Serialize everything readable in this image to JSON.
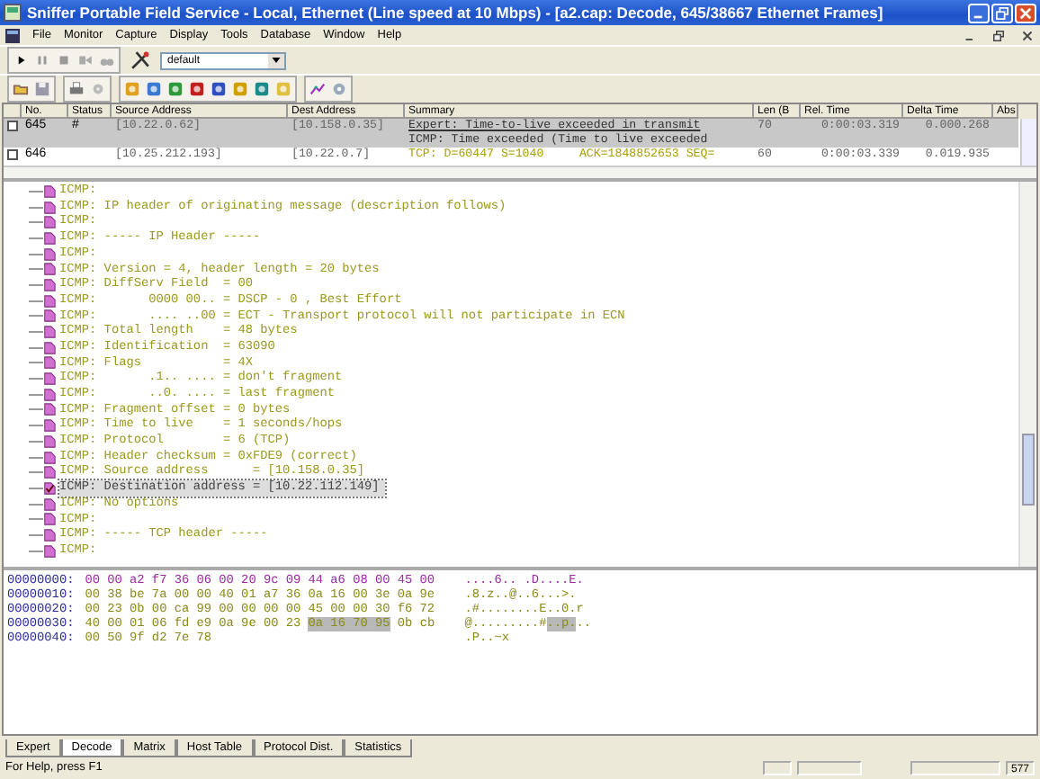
{
  "window": {
    "title": "Sniffer Portable Field Service - Local, Ethernet (Line speed at 10 Mbps) - [a2.cap: Decode, 645/38667 Ethernet Frames]"
  },
  "menu": [
    "File",
    "Monitor",
    "Capture",
    "Display",
    "Tools",
    "Database",
    "Window",
    "Help"
  ],
  "toolbar": {
    "profile": "default"
  },
  "packets": {
    "columns": [
      "No.",
      "Status",
      "Source Address",
      "Dest Address",
      "Summary",
      "Len (B",
      "Rel. Time",
      "Delta Time",
      "Abs"
    ],
    "rows": [
      {
        "checked": false,
        "selected": true,
        "no": "645",
        "status": "#",
        "source": "[10.22.0.62]",
        "dest": "[10.158.0.35]",
        "summary": [
          "Expert: Time-to-live exceeded in transmit",
          "ICMP: Time exceeded (Time to live exceeded"
        ],
        "len": "70",
        "rel_time": "0:00:03.319",
        "delta_time": "0.000.268"
      },
      {
        "checked": false,
        "selected": false,
        "no": "646",
        "status": "",
        "source": "[10.25.212.193]",
        "dest": "[10.22.0.7]",
        "summary": [
          "TCP: D=60447 S=1040     ACK=1848852653 SEQ="
        ],
        "len": "60",
        "rel_time": "0:00:03.339",
        "delta_time": "0.019.935"
      }
    ]
  },
  "decode": [
    {
      "text": "ICMP:",
      "selected": false
    },
    {
      "text": "ICMP: IP header of originating message (description follows)",
      "selected": false
    },
    {
      "text": "ICMP:",
      "selected": false
    },
    {
      "text": "ICMP: ----- IP Header -----",
      "selected": false
    },
    {
      "text": "ICMP:",
      "selected": false
    },
    {
      "text": "ICMP: Version = 4, header length = 20 bytes",
      "selected": false
    },
    {
      "text": "ICMP: DiffServ Field  = 00",
      "selected": false
    },
    {
      "text": "ICMP:       0000 00.. = DSCP - 0 , Best Effort",
      "selected": false
    },
    {
      "text": "ICMP:       .... ..00 = ECT - Transport protocol will not participate in ECN",
      "selected": false
    },
    {
      "text": "ICMP: Total length    = 48 bytes",
      "selected": false
    },
    {
      "text": "ICMP: Identification  = 63090",
      "selected": false
    },
    {
      "text": "ICMP: Flags           = 4X",
      "selected": false
    },
    {
      "text": "ICMP:       .1.. .... = don't fragment",
      "selected": false
    },
    {
      "text": "ICMP:       ..0. .... = last fragment",
      "selected": false
    },
    {
      "text": "ICMP: Fragment offset = 0 bytes",
      "selected": false
    },
    {
      "text": "ICMP: Time to live    = 1 seconds/hops",
      "selected": false
    },
    {
      "text": "ICMP: Protocol        = 6 (TCP)",
      "selected": false
    },
    {
      "text": "ICMP: Header checksum = 0xFDE9 (correct)",
      "selected": false
    },
    {
      "text": "ICMP: Source address      = [10.158.0.35]",
      "selected": false
    },
    {
      "text": "ICMP: Destination address = [10.22.112.149]",
      "selected": true
    },
    {
      "text": "ICMP: No options",
      "selected": false
    },
    {
      "text": "ICMP:",
      "selected": false
    },
    {
      "text": "ICMP: ----- TCP header -----",
      "selected": false
    },
    {
      "text": "ICMP:",
      "selected": false
    }
  ],
  "hex": [
    {
      "offset": "00000000:",
      "color": "#9a2aa0",
      "bytes": [
        {
          "text": "00 00 a2 f7 36 06 00 20 9c 09 44 a6 08 00 45 00",
          "selected": false
        }
      ],
      "ascii": [
        {
          "text": "....6.. .D....E.",
          "selected": false
        }
      ]
    },
    {
      "offset": "00000010:",
      "color": "#8a8a1a",
      "bytes": [
        {
          "text": "00 38 be 7a 00 00 40 01 a7 36 0a 16 00 3e 0a 9e",
          "selected": false
        }
      ],
      "ascii": [
        {
          "text": ".8.z..@..6...>.",
          "selected": false
        }
      ]
    },
    {
      "offset": "00000020:",
      "color": "#8a8a1a",
      "bytes": [
        {
          "text": "00 23 0b 00 ca 99 00 00 00 00 45 00 00 30 f6 72",
          "selected": false
        }
      ],
      "ascii": [
        {
          "text": ".#........E..0.r",
          "selected": false
        }
      ]
    },
    {
      "offset": "00000030:",
      "color": "#8a8a1a",
      "bytes": [
        {
          "text": "40 00 01 06 fd e9 0a 9e 00 23 ",
          "selected": false
        },
        {
          "text": "0a 16 70 95",
          "selected": true
        },
        {
          "text": " 0b cb",
          "selected": false
        }
      ],
      "ascii": [
        {
          "text": "@.........#",
          "selected": false
        },
        {
          "text": "..p.",
          "selected": true
        },
        {
          "text": "..",
          "selected": false
        }
      ]
    },
    {
      "offset": "00000040:",
      "color": "#8a8a1a",
      "bytes": [
        {
          "text": "00 50 9f d2 7e 78",
          "selected": false
        }
      ],
      "ascii": [
        {
          "text": ".P..~x",
          "selected": false
        }
      ]
    }
  ],
  "tabs": [
    {
      "label": "Expert",
      "selected": false
    },
    {
      "label": "Decode",
      "selected": true
    },
    {
      "label": "Matrix",
      "selected": false
    },
    {
      "label": "Host Table",
      "selected": false
    },
    {
      "label": "Protocol Dist.",
      "selected": false
    },
    {
      "label": "Statistics",
      "selected": false
    }
  ],
  "status_bar": {
    "help": "For Help, press F1",
    "count": "577"
  }
}
